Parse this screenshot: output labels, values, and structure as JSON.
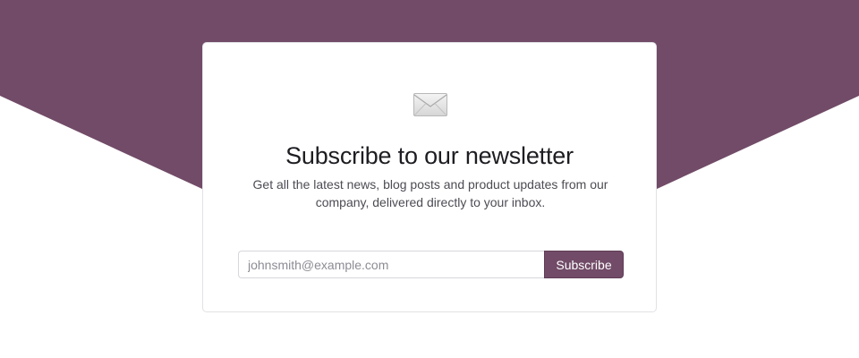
{
  "colors": {
    "brand": "#714b67",
    "background": "#ffffff"
  },
  "newsletter": {
    "icon": "envelope-icon",
    "title": "Subscribe to our newsletter",
    "description": "Get all the latest news, blog posts and product updates from our company, delivered directly to your inbox.",
    "email_placeholder": "johnsmith@example.com",
    "email_value": "",
    "subscribe_label": "Subscribe"
  }
}
